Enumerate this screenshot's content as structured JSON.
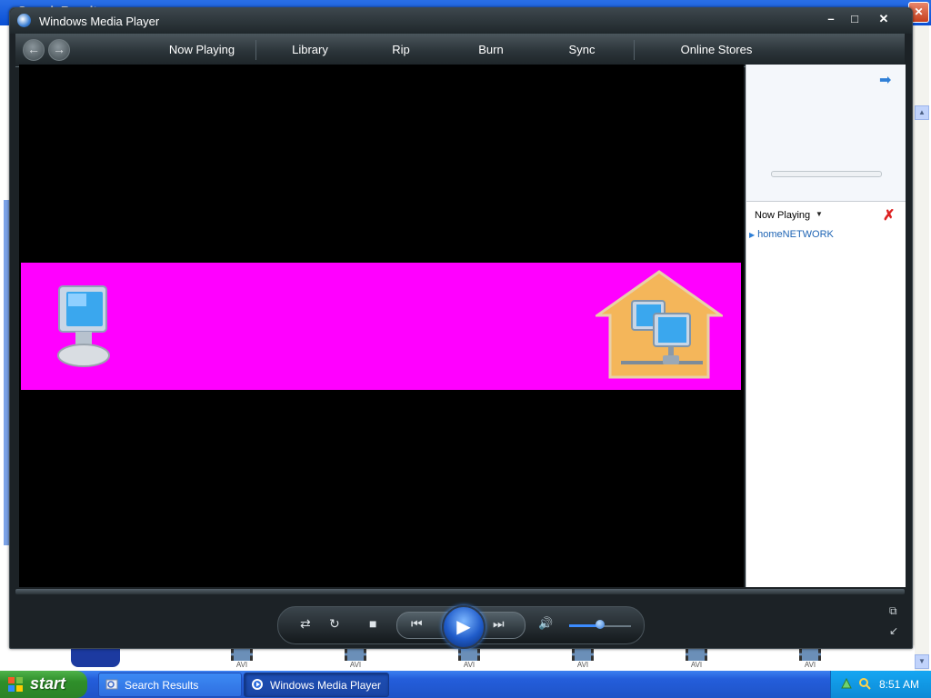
{
  "background": {
    "window_title": "Search Results",
    "avi_label": "AVI"
  },
  "wmp": {
    "title": "Windows Media Player",
    "window_buttons": {
      "minimize": "–",
      "maximize": "□",
      "close": "✕"
    },
    "nav": {
      "back": "←",
      "forward": "→",
      "tabs": [
        "Now Playing",
        "Library",
        "Rip",
        "Burn",
        "Sync",
        "Online Stores"
      ]
    },
    "side_panel": {
      "list_title": "Now Playing",
      "items": [
        "homeNETWORK"
      ]
    },
    "controls": {
      "shuffle": "⇄",
      "repeat": "↻",
      "stop": "■",
      "previous": "⏮",
      "play": "▶",
      "next": "⏭",
      "mute": "🔊",
      "volume_fraction": 0.5
    }
  },
  "taskbar": {
    "start_label": "start",
    "tasks": [
      "Search Results",
      "Windows Media Player"
    ],
    "active_task": "Windows Media Player",
    "clock": "8:51 AM"
  },
  "colors": {
    "wmp_frame": "#1c2226",
    "banner": "#ff00ff",
    "taskbar": "#245edb",
    "start": "#2f8f2a",
    "accent": "#3c8cff"
  }
}
